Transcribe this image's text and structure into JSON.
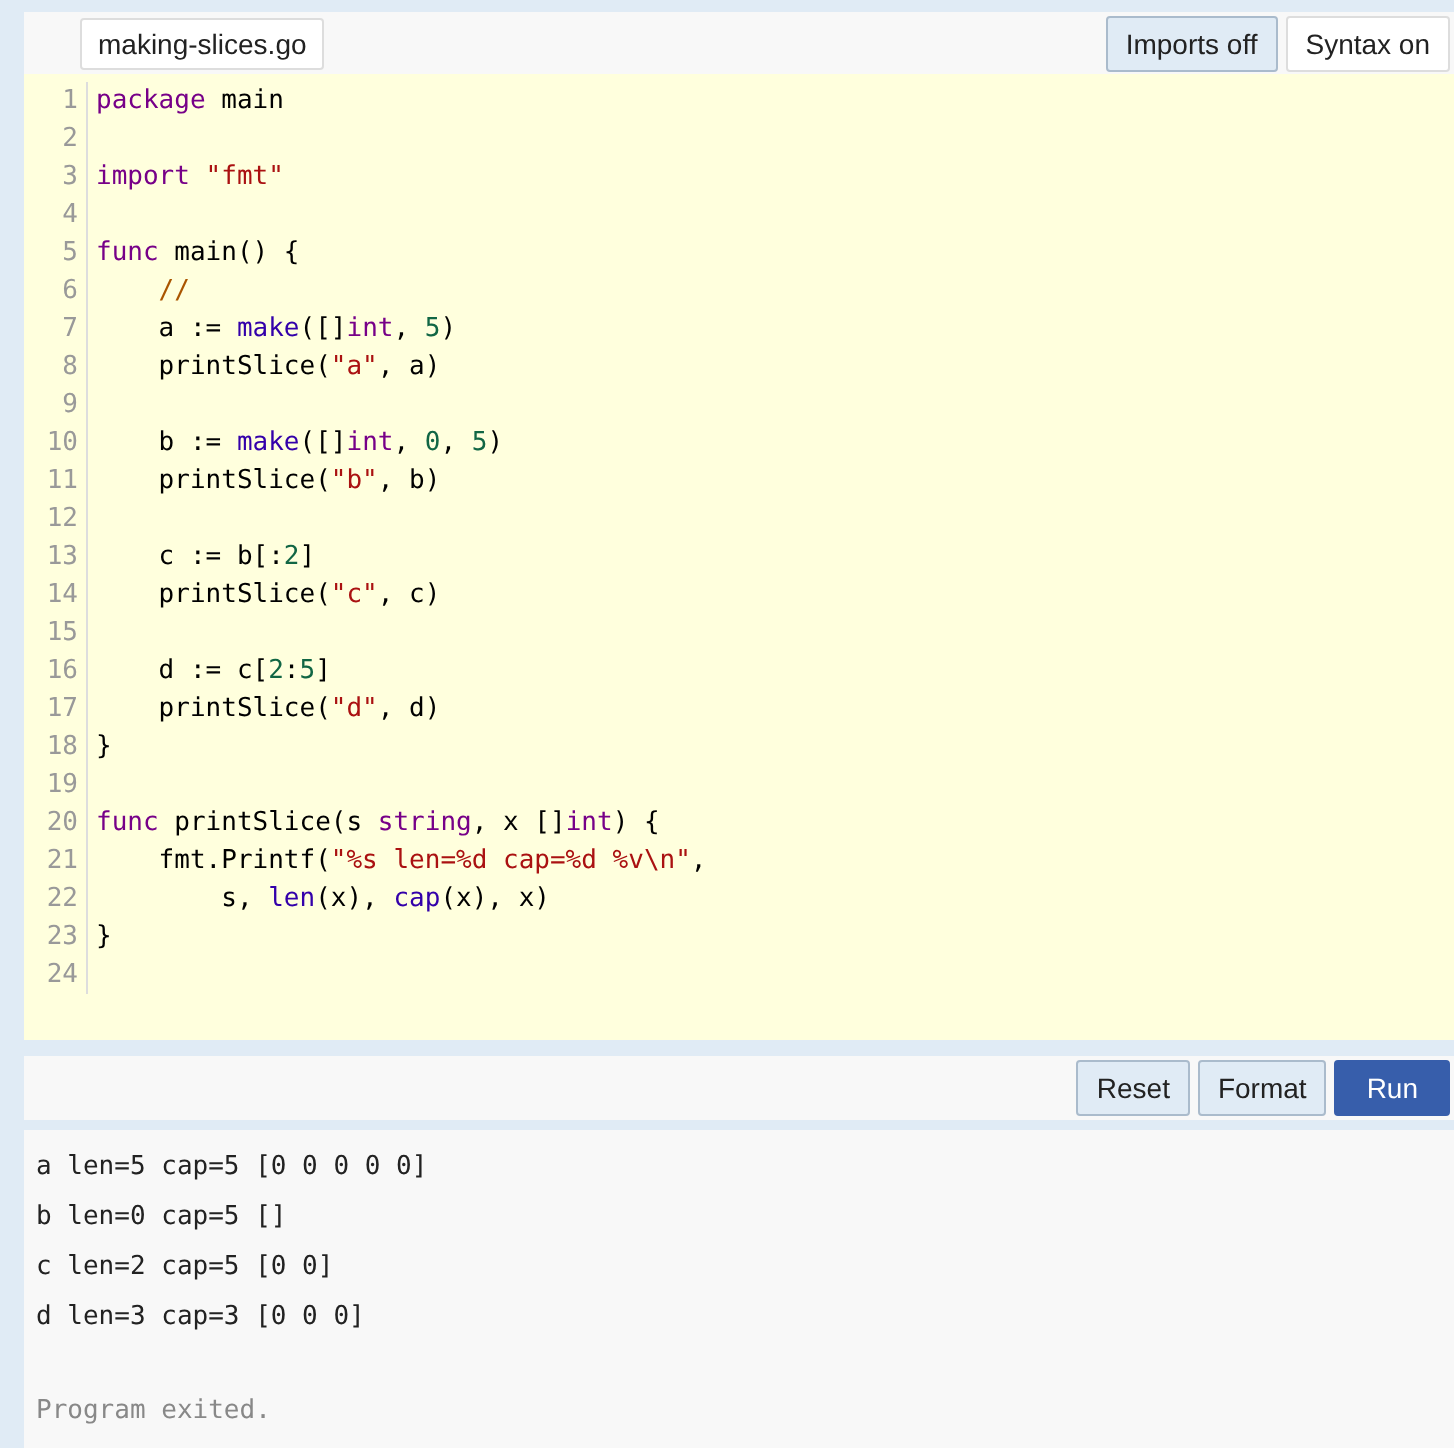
{
  "file_tab": "making-slices.go",
  "header_buttons": [
    {
      "label": "Imports off",
      "kind": "shaded"
    },
    {
      "label": "Syntax on",
      "kind": "plain"
    }
  ],
  "editor": {
    "lines": [
      {
        "n": "1",
        "tokens": [
          {
            "kind": "keyword",
            "text": "package"
          },
          {
            "kind": "plain",
            "text": " main"
          }
        ]
      },
      {
        "n": "2"
      },
      {
        "n": "3",
        "tokens": [
          {
            "kind": "keyword",
            "text": "import "
          },
          {
            "kind": "string",
            "text": "\"fmt\""
          }
        ]
      },
      {
        "n": "4"
      },
      {
        "n": "5",
        "tokens": [
          {
            "kind": "keyword",
            "text": "func"
          },
          {
            "kind": "plain",
            "text": " main() {"
          }
        ]
      },
      {
        "n": "6",
        "tokens": [
          {
            "kind": "comment",
            "text": "    //"
          }
        ]
      },
      {
        "n": "7",
        "tokens": [
          {
            "kind": "plain",
            "text": "    a := "
          },
          {
            "kind": "builtin",
            "text": "make"
          },
          {
            "kind": "plain",
            "text": "([]"
          },
          {
            "kind": "keyword",
            "text": "int"
          },
          {
            "kind": "plain",
            "text": ", "
          },
          {
            "kind": "number",
            "text": "5"
          },
          {
            "kind": "plain",
            "text": ")"
          }
        ]
      },
      {
        "n": "8",
        "tokens": [
          {
            "kind": "plain",
            "text": "    printSlice("
          },
          {
            "kind": "string",
            "text": "\"a\""
          },
          {
            "kind": "plain",
            "text": ", a)"
          }
        ]
      },
      {
        "n": "9"
      },
      {
        "n": "10",
        "tokens": [
          {
            "kind": "plain",
            "text": "    b := "
          },
          {
            "kind": "builtin",
            "text": "make"
          },
          {
            "kind": "plain",
            "text": "([]"
          },
          {
            "kind": "keyword",
            "text": "int"
          },
          {
            "kind": "plain",
            "text": ", "
          },
          {
            "kind": "number",
            "text": "0"
          },
          {
            "kind": "plain",
            "text": ", "
          },
          {
            "kind": "number",
            "text": "5"
          },
          {
            "kind": "plain",
            "text": ")"
          }
        ]
      },
      {
        "n": "11",
        "tokens": [
          {
            "kind": "plain",
            "text": "    printSlice("
          },
          {
            "kind": "string",
            "text": "\"b\""
          },
          {
            "kind": "plain",
            "text": ", b)"
          }
        ]
      },
      {
        "n": "12"
      },
      {
        "n": "13",
        "tokens": [
          {
            "kind": "plain",
            "text": "    c := b[:"
          },
          {
            "kind": "number",
            "text": "2"
          },
          {
            "kind": "plain",
            "text": "]"
          }
        ]
      },
      {
        "n": "14",
        "tokens": [
          {
            "kind": "plain",
            "text": "    printSlice("
          },
          {
            "kind": "string",
            "text": "\"c\""
          },
          {
            "kind": "plain",
            "text": ", c)"
          }
        ]
      },
      {
        "n": "15"
      },
      {
        "n": "16",
        "tokens": [
          {
            "kind": "plain",
            "text": "    d := c["
          },
          {
            "kind": "number",
            "text": "2"
          },
          {
            "kind": "plain",
            "text": ":"
          },
          {
            "kind": "number",
            "text": "5"
          },
          {
            "kind": "plain",
            "text": "]"
          }
        ]
      },
      {
        "n": "17",
        "tokens": [
          {
            "kind": "plain",
            "text": "    printSlice("
          },
          {
            "kind": "string",
            "text": "\"d\""
          },
          {
            "kind": "plain",
            "text": ", d)"
          }
        ]
      },
      {
        "n": "18",
        "tokens": [
          {
            "kind": "plain",
            "text": "}"
          }
        ]
      },
      {
        "n": "19"
      },
      {
        "n": "20",
        "tokens": [
          {
            "kind": "keyword",
            "text": "func"
          },
          {
            "kind": "plain",
            "text": " printSlice(s "
          },
          {
            "kind": "keyword",
            "text": "string"
          },
          {
            "kind": "plain",
            "text": ", x []"
          },
          {
            "kind": "keyword",
            "text": "int"
          },
          {
            "kind": "plain",
            "text": ") {"
          }
        ]
      },
      {
        "n": "21",
        "tokens": [
          {
            "kind": "plain",
            "text": "    fmt.Printf("
          },
          {
            "kind": "string",
            "text": "\"%s len=%d cap=%d %v\\n\""
          },
          {
            "kind": "plain",
            "text": ","
          }
        ]
      },
      {
        "n": "22",
        "tokens": [
          {
            "kind": "plain",
            "text": "        s, "
          },
          {
            "kind": "builtin",
            "text": "len"
          },
          {
            "kind": "plain",
            "text": "(x), "
          },
          {
            "kind": "builtin",
            "text": "cap"
          },
          {
            "kind": "plain",
            "text": "(x), x)"
          }
        ]
      },
      {
        "n": "23",
        "tokens": [
          {
            "kind": "plain",
            "text": "}"
          }
        ]
      },
      {
        "n": "24"
      }
    ]
  },
  "action_buttons": [
    {
      "label": "Reset",
      "kind": "shaded"
    },
    {
      "label": "Format",
      "kind": "shaded"
    },
    {
      "label": "Run",
      "kind": "primary"
    }
  ],
  "output": {
    "lines": [
      "a len=5 cap=5 [0 0 0 0 0]",
      "b len=0 cap=5 []",
      "c len=2 cap=5 [0 0]",
      "d len=3 cap=3 [0 0 0]"
    ],
    "status": "Program exited."
  }
}
